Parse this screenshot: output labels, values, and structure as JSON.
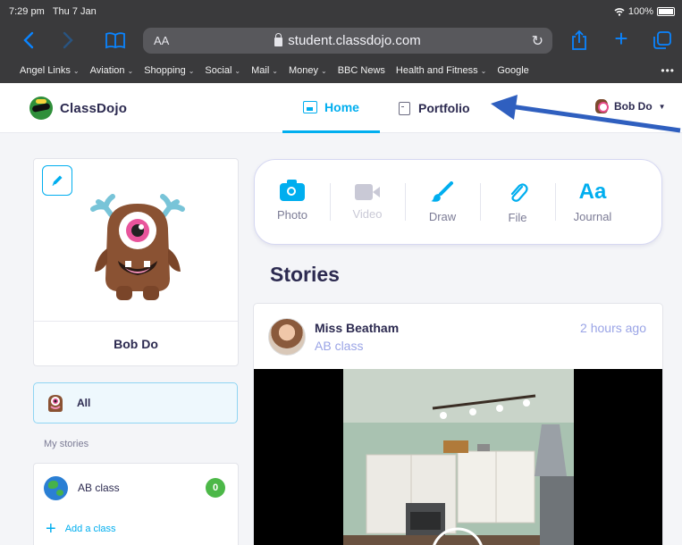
{
  "status_bar": {
    "time": "7:29 pm",
    "date": "Thu 7 Jan",
    "battery": "100%"
  },
  "browser": {
    "aa_label": "AA",
    "url": "student.classdojo.com",
    "bookmarks": [
      "Angel Links",
      "Aviation",
      "Shopping",
      "Social",
      "Mail",
      "Money",
      "BBC News",
      "Health and Fitness",
      "Google"
    ],
    "bookmarks_with_menu": [
      true,
      true,
      true,
      true,
      true,
      true,
      false,
      true,
      false
    ],
    "more": "•••"
  },
  "header": {
    "brand": "ClassDojo",
    "nav": {
      "home": "Home",
      "portfolio": "Portfolio"
    },
    "user": "Bob Do"
  },
  "profile": {
    "name": "Bob Do"
  },
  "filters": {
    "all": "All",
    "my_stories_label": "My stories"
  },
  "classes": [
    {
      "name": "AB class",
      "count": "0"
    }
  ],
  "add_class": "Add a class",
  "composer": {
    "photo": "Photo",
    "video": "Video",
    "draw": "Draw",
    "file": "File",
    "journal": "Journal",
    "journal_icon": "Aa"
  },
  "stories": {
    "title": "Stories",
    "items": [
      {
        "author": "Miss Beatham",
        "class": "AB class",
        "time": "2 hours ago"
      }
    ]
  },
  "colors": {
    "accent": "#00aeef",
    "ink": "#2c2a50",
    "badge": "#4cb848",
    "annotation_arrow": "#2f5fbf"
  }
}
